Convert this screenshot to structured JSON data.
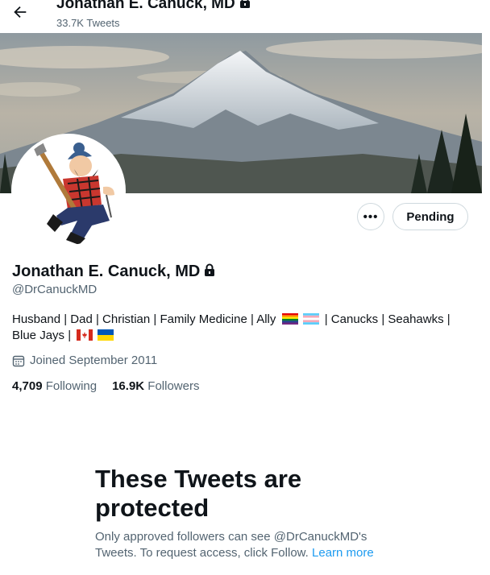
{
  "header": {
    "name": "Jonathan E. Canuck, MD",
    "tweet_count": "33.7K Tweets"
  },
  "profile": {
    "name": "Jonathan E. Canuck, MD",
    "handle": "@DrCanuckMD",
    "bio_part1": "Husband | Dad | Christian | Family Medicine | Ally",
    "bio_part2": "| Canucks | Seahawks |",
    "bio_part3": "Blue Jays |",
    "joined": "Joined September 2011",
    "following_count": "4,709",
    "following_label": "Following",
    "followers_count": "16.9K",
    "followers_label": "Followers"
  },
  "actions": {
    "more_label": "•••",
    "pending_label": "Pending"
  },
  "protected": {
    "title": "These Tweets are protected",
    "text": "Only approved followers can see @DrCanuckMD's Tweets. To request access, click Follow.",
    "link": "Learn more"
  },
  "icons": {
    "back": "arrow-left-icon",
    "lock": "lock-icon",
    "calendar": "calendar-icon"
  },
  "colors": {
    "link": "#1d9bf0",
    "secondary_text": "#536471",
    "border": "#cfd9de"
  }
}
